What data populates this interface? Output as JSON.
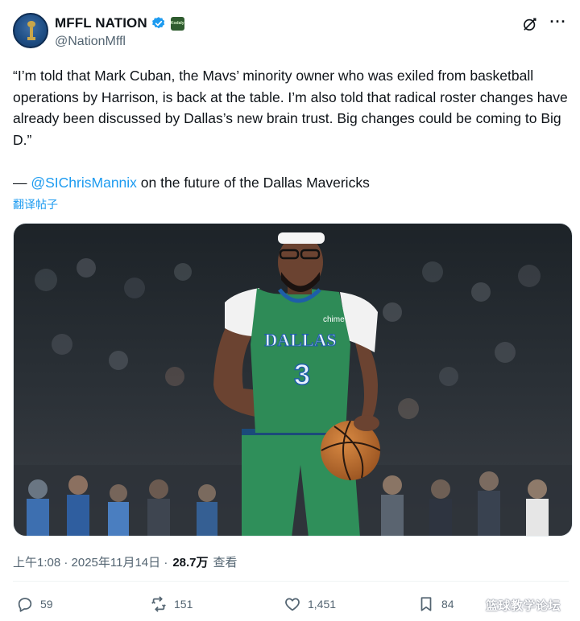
{
  "account": {
    "display_name": "MFFL NATION",
    "handle": "@NationMffl",
    "affiliate_badge": "Kodaly"
  },
  "tweet": {
    "text": "“I’m told that Mark Cuban, the Mavs’ minority owner who was exiled from basketball operations by Harrison, is back at the table. I’m also told that radical roster changes have already been discussed by Dallas’s new brain trust. Big changes could be coming to Big D.”",
    "credit_prefix": "— ",
    "credit_mention": "@SIChrisMannix",
    "credit_suffix": " on the future of the Dallas Mavericks",
    "translate_label": "翻译帖子"
  },
  "media": {
    "jersey_text": "DALLAS",
    "jersey_number": "3",
    "sponsor": "chime"
  },
  "meta": {
    "timestamp": "上午1:08 · 2025年11月14日 ·",
    "views_count": "28.7万",
    "views_label": "查看"
  },
  "actions": {
    "replies": "59",
    "reposts": "151",
    "likes": "1,451",
    "bookmarks": "84"
  },
  "watermark": "篮球教学论坛",
  "colors": {
    "link": "#1d9bf0",
    "secondary_text": "#536471",
    "jersey_green": "#2e8b57"
  },
  "icons": [
    "verified-badge-icon",
    "grok-icon",
    "more-icon",
    "reply-icon",
    "repost-icon",
    "like-icon",
    "bookmark-icon"
  ]
}
